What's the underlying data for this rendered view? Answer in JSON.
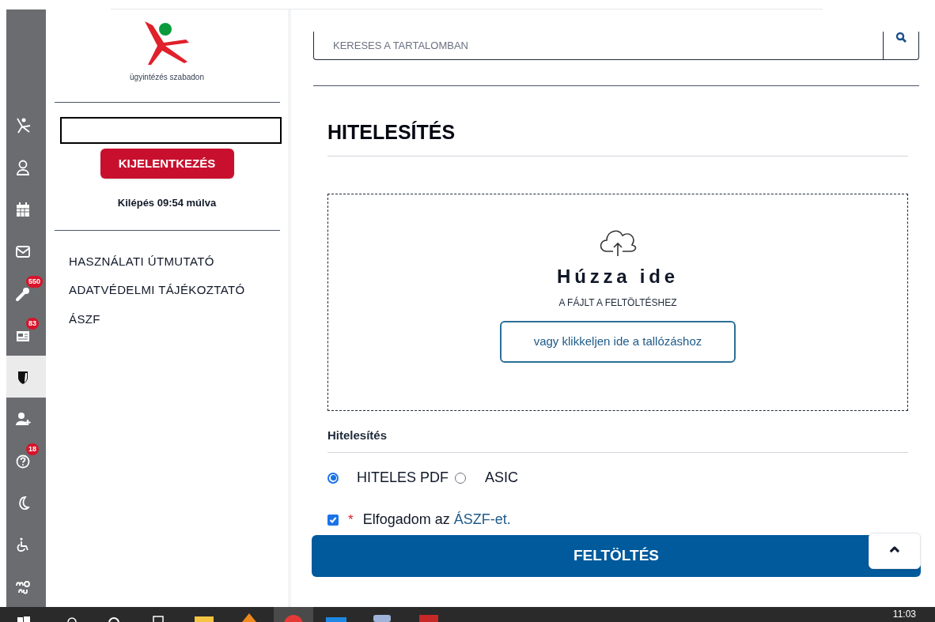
{
  "rail": {
    "items": [
      {
        "selected": false
      },
      {
        "selected": false
      },
      {
        "selected": false
      },
      {
        "selected": false
      },
      {
        "selected": false,
        "badge": "550"
      },
      {
        "selected": false,
        "badge": "83"
      },
      {
        "selected": true
      },
      {
        "selected": false
      },
      {
        "selected": false,
        "badge": "18"
      },
      {
        "selected": false
      },
      {
        "selected": false
      },
      {
        "selected": false
      }
    ]
  },
  "sidebar": {
    "logo_caption": "ügyintézés szabadon",
    "logout_button": "KIJELENTKEZÉS",
    "session_timer": "Kilépés 09:54 múlva",
    "links": [
      "HASZNÁLATI ÚTMUTATÓ",
      "ADATVÉDELMI TÁJÉKOZTATÓ",
      "ÁSZF"
    ]
  },
  "search": {
    "placeholder": "KERESES A TARTALOMBAN"
  },
  "page_title": "HITELESÍTÉS",
  "dropzone": {
    "title": "Húzza ide",
    "subtitle": "A FÁJLT A FELTÖLTÉSHEZ",
    "browse_button": "vagy klikkeljen ide a tallózáshoz"
  },
  "format": {
    "label": "Hitelesítés",
    "options": [
      {
        "label": "HITELES PDF",
        "selected": true
      },
      {
        "label": "ASIC",
        "selected": false
      }
    ]
  },
  "terms": {
    "checked": true,
    "required_mark": "*",
    "text": "Elfogadom az ",
    "link": "ÁSZF-et."
  },
  "upload_button": "FELTÖLTÉS",
  "scroll_top_button": "⌃",
  "taskbar": {
    "clock": "11:03"
  }
}
